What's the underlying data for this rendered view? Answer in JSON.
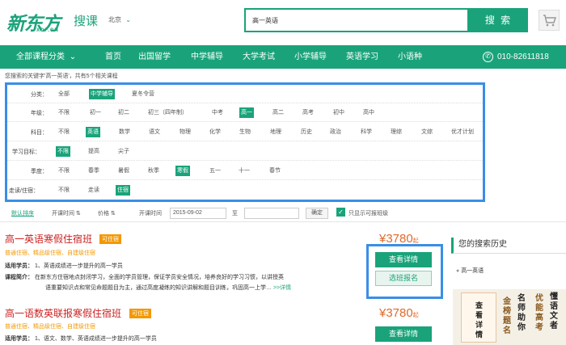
{
  "header": {
    "logo_main": "新东方",
    "logo_sub": "XDF.CN",
    "logo_course": "搜课",
    "city": "北京",
    "search_value": "高一英语",
    "search_button": "搜 索"
  },
  "nav": {
    "all_categories": "全部课程分类",
    "items": [
      "首页",
      "出国留学",
      "中学辅导",
      "大学考试",
      "小学辅导",
      "英语学习",
      "小语种"
    ],
    "phone": "010-82611818"
  },
  "result_info": "您搜索的关键字'高一英语'，共有5个相关课程",
  "filters": {
    "category": {
      "label": "分类：",
      "options": [
        "全部",
        "中学辅导",
        "夏冬令营"
      ],
      "selected": 1
    },
    "grade": {
      "label": "年级：",
      "options": [
        "不限",
        "初一",
        "初二",
        "初三（四年制）",
        "中考",
        "高一",
        "高二",
        "高考",
        "初中",
        "高中"
      ],
      "selected": 5
    },
    "subject": {
      "label": "科目：",
      "options": [
        "不限",
        "英语",
        "数学",
        "语文",
        "物理",
        "化学",
        "生物",
        "地理",
        "历史",
        "政治",
        "科学",
        "理综",
        "文综",
        "优才计划"
      ],
      "selected": 1
    },
    "goal": {
      "label": "学习目标：",
      "options": [
        "不限",
        "提高",
        "尖子"
      ],
      "selected": 0
    },
    "season": {
      "label": "季度：",
      "options": [
        "不限",
        "春季",
        "暑假",
        "秋季",
        "寒假",
        "五一",
        "十一",
        "春节"
      ],
      "selected": 4
    },
    "boarding": {
      "label": "走读/住宿：",
      "options": [
        "不限",
        "走读",
        "住宿"
      ],
      "selected": 2
    }
  },
  "sortbar": {
    "default_sort": "默认排序",
    "start_time": "开课时间",
    "price": "价格",
    "start_time_label": "开课时间",
    "date_value": "2015-09-02",
    "to": "至",
    "confirm": "确定",
    "only_available": "只显示可报班级",
    "only_available_checked": true
  },
  "courses": [
    {
      "title": "高一英语寒假住宿班",
      "tag": "可住宿",
      "features": "普通住宿、精品级住宿、自建级住宿",
      "audience_label": "适用学员：",
      "audience": "1、英语成绩进一步提升的高一学员",
      "intro_label": "课程简介：",
      "intro_line1": "在新东方住宿地点封闭学习，全面的学员管理，保证学员安全情况，培养良好的学习习惯，以讲授英",
      "intro_line2": "语重要知识点和常见命题题目为主，通过高度凝练的知识讲解和题目训练，巩固高一上学…",
      "more": ">>详情",
      "price": "¥3780",
      "price_unit": "起",
      "detail_button": "查看详情",
      "enroll_button": "选班报名"
    },
    {
      "title": "高一语数英联报寒假住宿班",
      "tag": "可住宿",
      "features": "普通住宿、精品级住宿、自建级住宿",
      "audience_label": "适用学员：",
      "audience": "1、语文、数学、英语成绩进一步提升的高一学员",
      "price": "¥3780",
      "price_unit": "起",
      "detail_button": "查看详情"
    }
  ],
  "sidebar": {
    "history_title": "您的搜索历史",
    "history_items": [
      "高一英语"
    ],
    "ad_columns": [
      "懂语文者",
      "优能高考",
      "名师助你",
      "金榜题名",
      "查看详情"
    ]
  },
  "colors": {
    "brand": "#1aa37a",
    "highlight": "#3a8ee6",
    "price": "#e06a2c",
    "title": "#cc2222",
    "tag": "#f39800"
  }
}
